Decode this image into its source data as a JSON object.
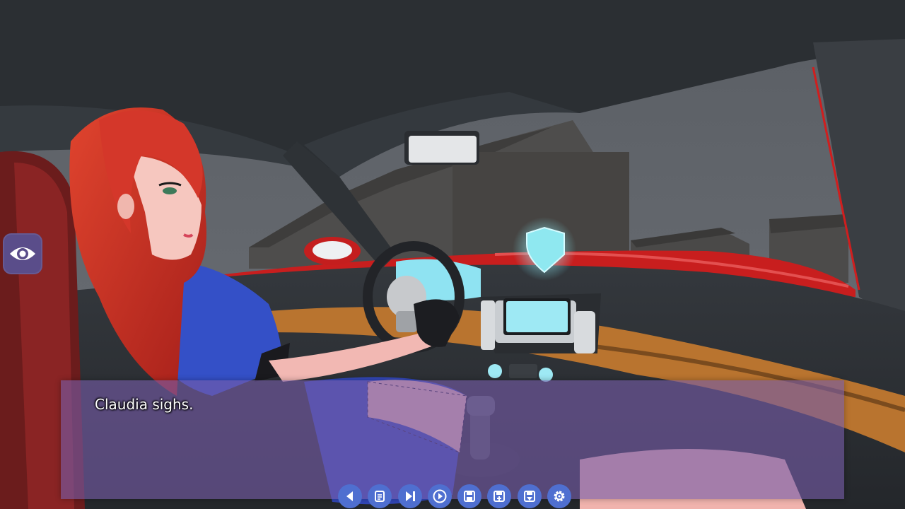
{
  "dialogue": {
    "text": "Claudia sighs."
  },
  "hide_ui_button": {
    "icon": "eye-icon"
  },
  "quick_menu": [
    {
      "id": "back",
      "icon": "triangle-left-icon"
    },
    {
      "id": "history",
      "icon": "scroll-icon"
    },
    {
      "id": "skip",
      "icon": "skip-forward-icon"
    },
    {
      "id": "auto",
      "icon": "play-circle-icon"
    },
    {
      "id": "save",
      "icon": "floppy-disk-icon"
    },
    {
      "id": "quick-save",
      "icon": "floppy-disk-plus-icon"
    },
    {
      "id": "quick-load",
      "icon": "floppy-disk-arrow-icon"
    },
    {
      "id": "preferences",
      "icon": "gear-icon"
    }
  ],
  "colors": {
    "dialogue_box": "#765ca8",
    "quick_menu_button": "#4f6fd0",
    "hide_ui_button": "#5a4d8a",
    "car_body": "#c81e1e"
  }
}
